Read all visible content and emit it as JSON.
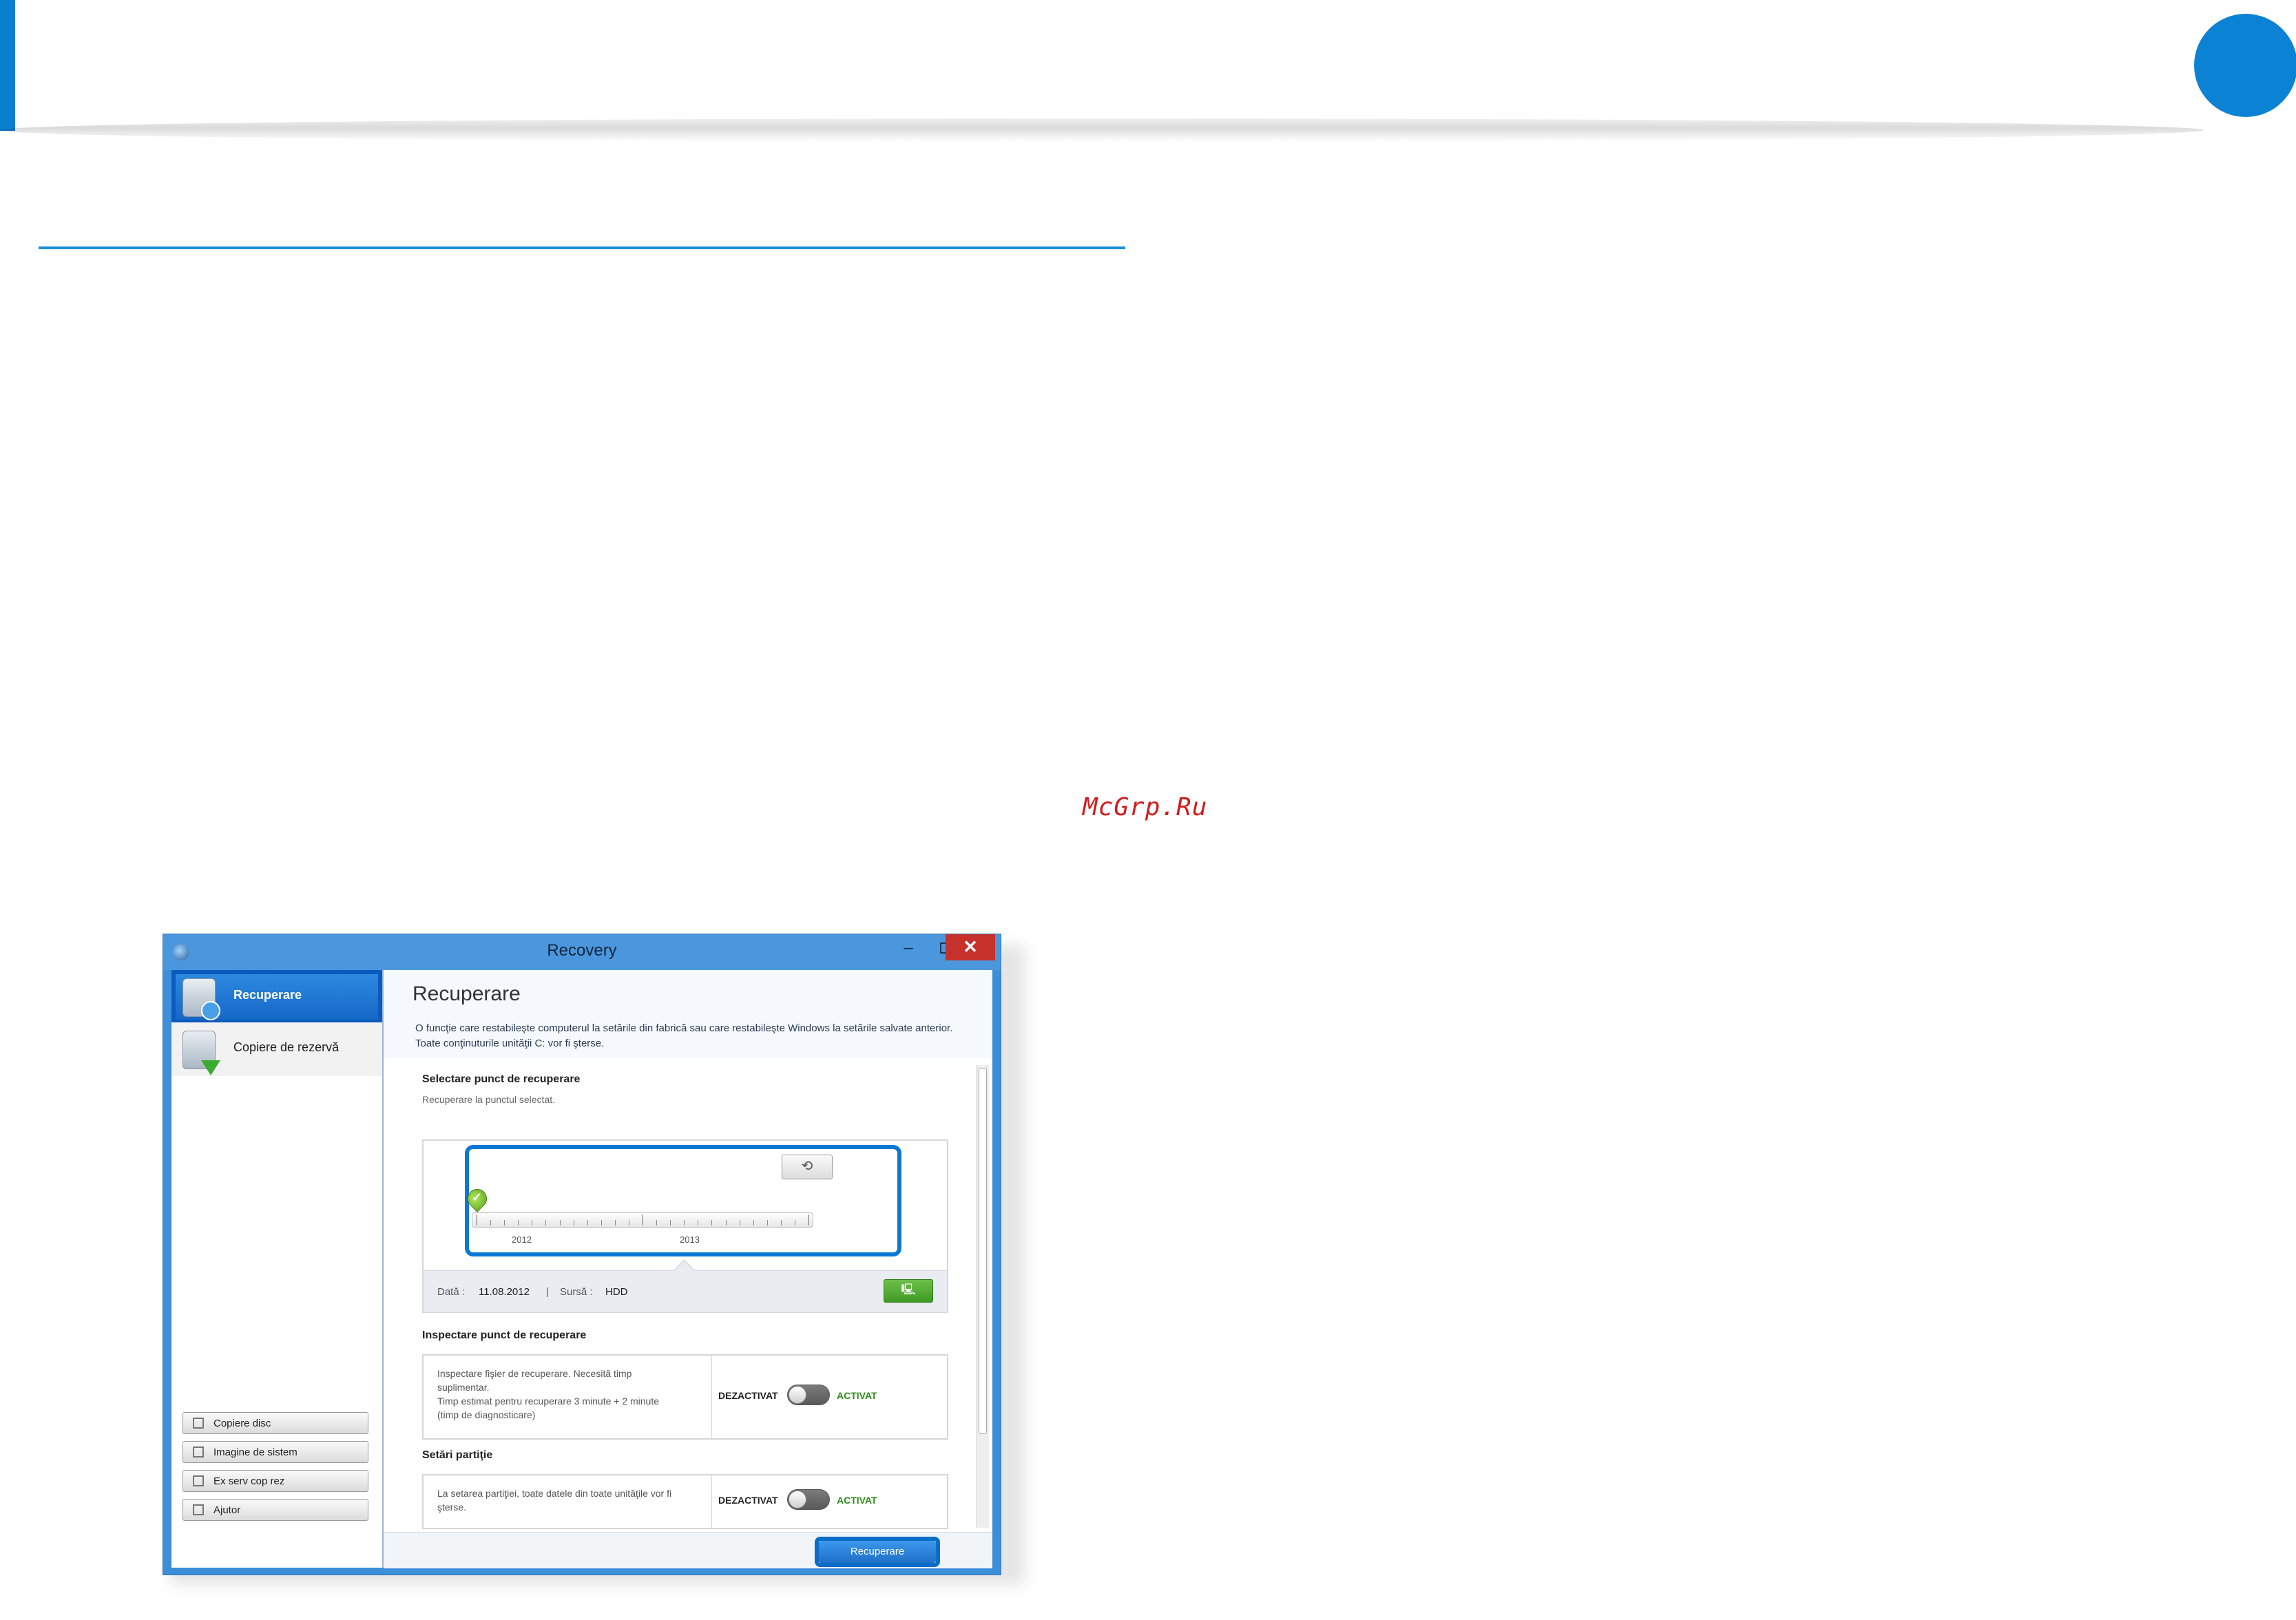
{
  "page": {
    "watermark": "McGrp.Ru",
    "colors": {
      "accent": "#0b82d4",
      "window_frame": "#3d8ed8",
      "close_button": "#c7312b",
      "green": "#3f9a24"
    }
  },
  "window": {
    "title": "Recovery",
    "controls": {
      "minimize": "–",
      "close": "✕"
    }
  },
  "sidebar": {
    "items": [
      {
        "label": "Recuperare",
        "icon": "recovery-disk-icon",
        "active": true
      },
      {
        "label": "Copiere de rezervă",
        "icon": "backup-download-icon",
        "active": false
      }
    ],
    "buttons": [
      {
        "label": "Copiere disc",
        "icon": "disk-copy-icon"
      },
      {
        "label": "Imagine de sistem",
        "icon": "system-image-icon"
      },
      {
        "label": "Ex serv cop rez",
        "icon": "export-backup-icon"
      },
      {
        "label": "Ajutor",
        "icon": "help-icon"
      }
    ]
  },
  "main": {
    "title": "Recuperare",
    "description_line1": "O funcţie care restabileşte computerul la setările din fabrică sau care restabileşte Windows la setările salvate anterior.",
    "description_line2": "Toate conţinuturile unităţii C: vor fi şterse.",
    "restore_point": {
      "section_title": "Selectare punct de recuperare",
      "section_subtitle": "Recuperare la punctul selectat.",
      "timeline_years": [
        "2012",
        "2013"
      ],
      "date_label": "Dată :",
      "date_value": "11.08.2012",
      "separator": "|",
      "source_label": "Sursă :",
      "source_value": "HDD"
    },
    "inspect": {
      "section_title": "Inspectare punct de recuperare",
      "text_line1": "Inspectare fişier de recuperare. Necesită timp",
      "text_line2": "suplimentar.",
      "text_line3": "Timp estimat pentru recuperare 3 minute + 2 minute",
      "text_line4": "(timp de diagnosticare)",
      "off_label": "DEZACTIVAT",
      "on_label": "ACTIVAT",
      "enabled": false
    },
    "partition": {
      "section_title": "Setări partiţie",
      "text_line1": "La setarea partiţiei, toate datele din toate unităţile vor fi",
      "text_line2": "şterse.",
      "off_label": "DEZACTIVAT",
      "on_label": "ACTIVAT",
      "enabled": false
    },
    "action_button": "Recuperare"
  }
}
